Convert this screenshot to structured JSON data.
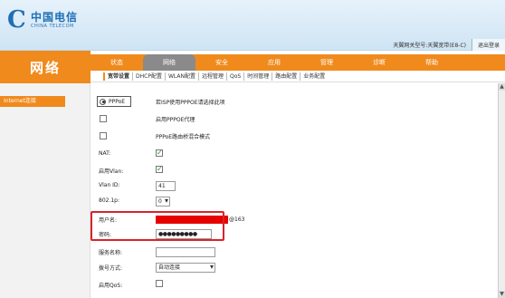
{
  "header": {
    "logo_cn": "中国电信",
    "logo_en": "CHINA TELECOM",
    "logo_mark": "C",
    "model_text": "天翼网关型号:天翼宽带(E8-C)",
    "logout": "退出登录"
  },
  "side_title": "网络",
  "main_nav": [
    {
      "label": "状态"
    },
    {
      "label": "网络"
    },
    {
      "label": "安全"
    },
    {
      "label": "应用"
    },
    {
      "label": "管理"
    },
    {
      "label": "诊断"
    },
    {
      "label": "帮助"
    }
  ],
  "sub_nav": [
    {
      "label": "宽带设置"
    },
    {
      "label": "DHCP配置"
    },
    {
      "label": "WLAN配置"
    },
    {
      "label": "远程管理"
    },
    {
      "label": "QoS"
    },
    {
      "label": "时间管理"
    },
    {
      "label": "路由配置"
    },
    {
      "label": "业务配置"
    }
  ],
  "sidebar": {
    "item": "Internet连接"
  },
  "form": {
    "pppoe_label": "PPPoE",
    "pppoe_desc": "若ISP使用PPPOE请选择此项",
    "proxy_desc": "启用PPPOE代理",
    "bridge_desc": "PPPoE路由桥混合模式",
    "nat_label": "NAT:",
    "vlan_enable_label": "启用Vlan:",
    "vlan_id_label": "Vlan ID:",
    "vlan_id_value": "41",
    "dot1p_label": "802.1p:",
    "dot1p_value": "0",
    "username_label": "用户名:",
    "username_suffix": "@163",
    "password_label": "密码:",
    "password_value": "●●●●●●●●●",
    "service_name_label": "服务名称:",
    "service_name_value": "",
    "dial_mode_label": "拨号方式:",
    "dial_mode_value": "自动连接",
    "qos_label": "启用QoS:"
  },
  "colors": {
    "accent": "#f08a1c",
    "highlight": "#d8232a",
    "mask": "#e60000"
  }
}
